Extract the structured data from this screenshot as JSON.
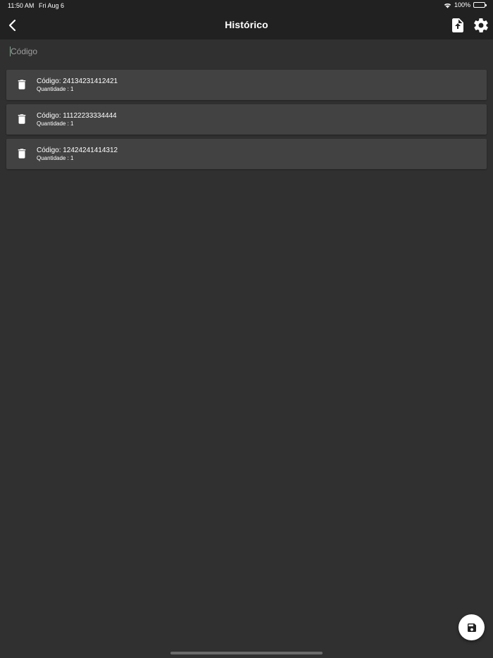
{
  "status_bar": {
    "time": "11:50 AM",
    "date": "Fri Aug 6",
    "battery": "100%",
    "battery_level": 1.0
  },
  "app_bar": {
    "title": "Histórico",
    "icons": {
      "back": "arrow-back-icon",
      "upload": "file-upload-icon",
      "settings": "gear-icon"
    }
  },
  "search": {
    "placeholder": "Código",
    "value": ""
  },
  "history": [
    {
      "code": "Código: 24134231412421",
      "quantity": "Quantidade : 1"
    },
    {
      "code": "Código: 11122233334444",
      "quantity": "Quantidade : 1"
    },
    {
      "code": "Código: 12424241414312",
      "quantity": "Quantidade : 1"
    }
  ],
  "fab": {
    "icon": "save-icon"
  },
  "colors": {
    "background": "#303030",
    "app_bar": "#212121",
    "card": "#424242",
    "text": "#ffffff",
    "placeholder": "#9e9e9e",
    "cursor": "#6fae8a"
  }
}
